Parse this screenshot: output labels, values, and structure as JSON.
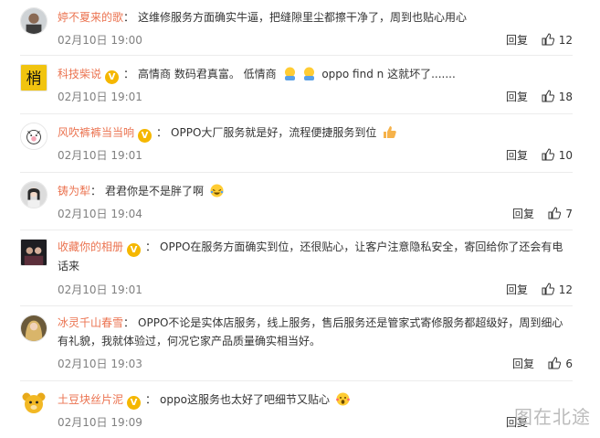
{
  "comments": [
    {
      "user": "婷不夏来的歌",
      "vip": false,
      "separator": "：",
      "text": "这维修服务方面确实牛逼，把缝隙里尘都擦干净了，周到也贴心用心",
      "time": "02月10日 19:00",
      "reply": "回复",
      "likes": "12",
      "avatar": "photo-avatar-man"
    },
    {
      "user": "科技柴说",
      "vip": true,
      "separator": "：",
      "text_before_emoji": "高情商 数码君真富。 低情商",
      "text_after_emoji": "oppo find n 这就坏了.......",
      "emoji": [
        "laughing-emoji",
        "laughing-emoji"
      ],
      "time": "02月10日 19:01",
      "reply": "回复",
      "likes": "18",
      "avatar": "calligraphy-avatar"
    },
    {
      "user": "风吹裤裤当当响",
      "vip": true,
      "separator": "：",
      "text": "OPPO大厂服务就是好，流程便捷服务到位",
      "emoji": "thumbs-up-emoji",
      "time": "02月10日 19:01",
      "reply": "回复",
      "likes": "10",
      "avatar": "cartoon-pig-avatar"
    },
    {
      "user": "铸为犁",
      "vip": false,
      "separator": "：",
      "text": "君君你是不是胖了啊",
      "emoji": "crying-laughing-emoji",
      "time": "02月10日 19:04",
      "reply": "回复",
      "likes": "7",
      "avatar": "photo-avatar-woman"
    },
    {
      "user": "收藏你的相册",
      "vip": true,
      "separator": "：",
      "text": "OPPO在服务方面确实到位，还很贴心，让客户注意隐私安全，寄回给你了还会有电话来",
      "time": "02月10日 19:01",
      "reply": "回复",
      "likes": "12",
      "avatar": "dark-photo-avatar"
    },
    {
      "user": "冰灵千山春雪",
      "vip": false,
      "separator": "：",
      "text": "OPPO不论是实体店服务，线上服务，售后服务还是管家式寄修服务都超级好，周到细心有礼貌，我就体验过，何况它家产品质量确实相当好。",
      "time": "02月10日 19:03",
      "reply": "回复",
      "likes": "6",
      "avatar": "blonde-photo-avatar"
    },
    {
      "user": "土豆块丝片泥",
      "vip": true,
      "separator": "：",
      "text": "oppo这服务也太好了吧细节又贴心",
      "emoji": "surprised-emoji",
      "time": "02月10日 19:09",
      "reply": "回复",
      "likes": "",
      "avatar": "bear-avatar"
    }
  ],
  "watermark": "图在北途",
  "colors": {
    "username": "#eb7350",
    "vip_badge": "#f5b700",
    "meta": "#808080",
    "divider": "#ececec"
  }
}
